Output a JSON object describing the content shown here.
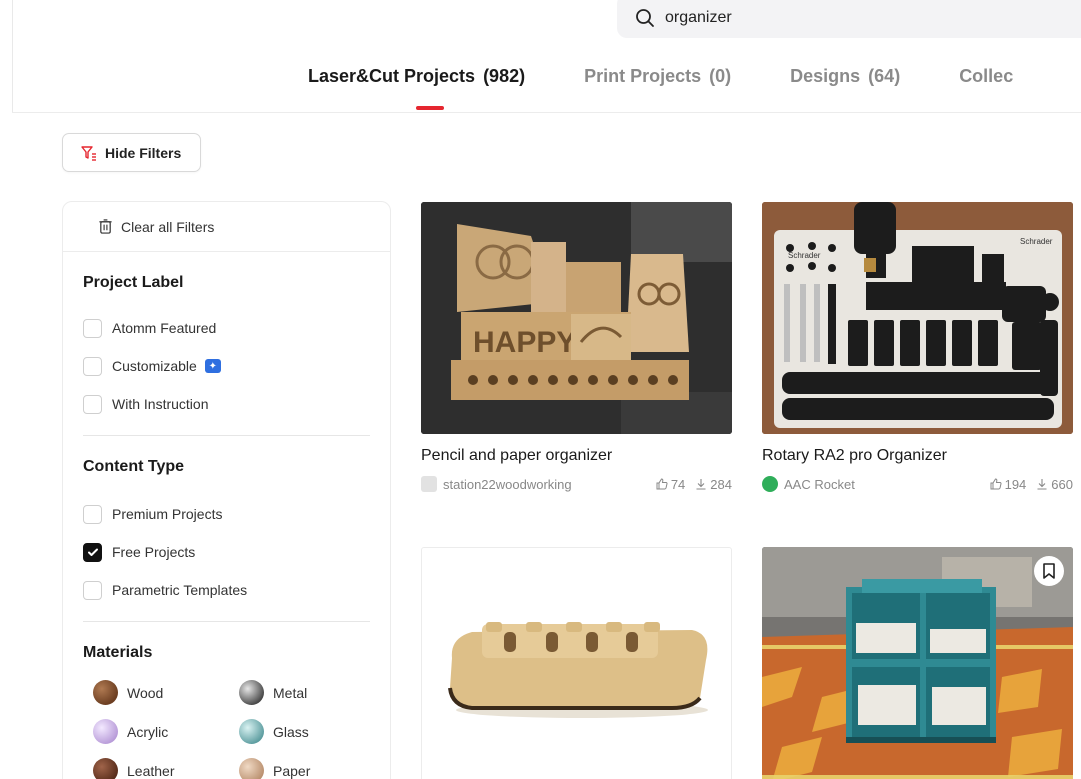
{
  "search": {
    "value": "organizer"
  },
  "tabs": [
    {
      "label": "Laser&Cut Projects",
      "count": "(982)"
    },
    {
      "label": "Print Projects",
      "count": "(0)"
    },
    {
      "label": "Designs",
      "count": "(64)"
    },
    {
      "label": "Collec",
      "count": ""
    }
  ],
  "toolbar": {
    "hide_filters": "Hide Filters"
  },
  "filters": {
    "clear_all": "Clear all Filters",
    "project_label": {
      "title": "Project Label",
      "options": [
        "Atomm Featured",
        "Customizable",
        "With Instruction"
      ]
    },
    "content_type": {
      "title": "Content Type",
      "options": [
        "Premium Projects",
        "Free Projects",
        "Parametric Templates"
      ],
      "checked": "Free Projects"
    },
    "materials": {
      "title": "Materials",
      "items": [
        "Wood",
        "Metal",
        "Acrylic",
        "Glass",
        "Leather",
        "Paper"
      ]
    }
  },
  "cards": [
    {
      "title": "Pencil and paper organizer",
      "author": "station22woodworking",
      "likes": "74",
      "downloads": "284",
      "thumb_text": "HAPPY"
    },
    {
      "title": "Rotary RA2 pro Organizer",
      "author": "AAC Rocket",
      "likes": "194",
      "downloads": "660",
      "thumb_text": "Schrader"
    },
    {
      "title": "",
      "author": "",
      "likes": "",
      "downloads": ""
    },
    {
      "title": "",
      "author": "",
      "likes": "",
      "downloads": ""
    }
  ],
  "colors": {
    "accent_red": "#e5262f",
    "checkbox_checked": "#111111"
  }
}
